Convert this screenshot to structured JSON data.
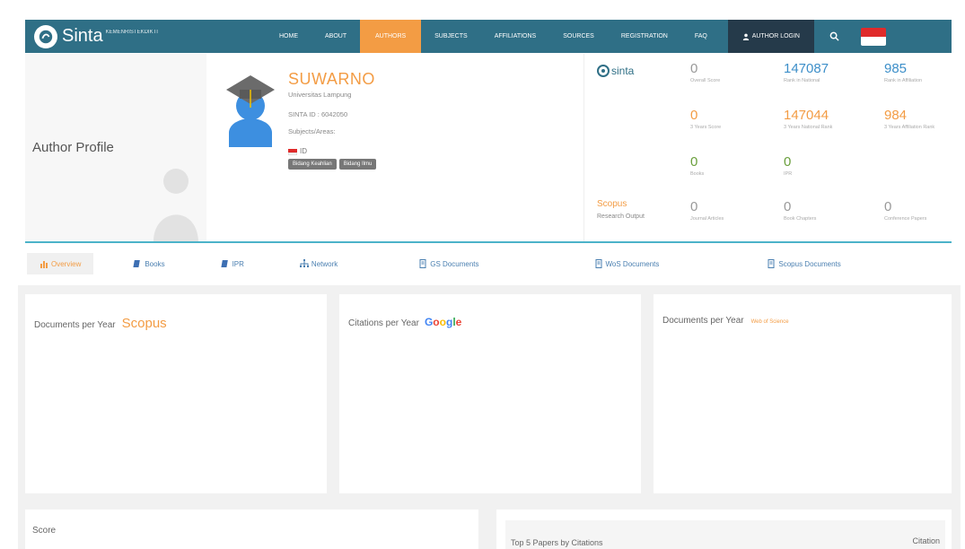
{
  "nav": {
    "brand": "Sinta",
    "brand_sub": "KEMENRISTEKDIKTI",
    "items": [
      "HOME",
      "ABOUT",
      "AUTHORS",
      "SUBJECTS",
      "AFFILIATIONS",
      "SOURCES",
      "REGISTRATION",
      "FAQ"
    ],
    "login_label": "AUTHOR LOGIN"
  },
  "profile": {
    "section_title": "Author Profile",
    "name": "SUWARNO",
    "affiliation": "Universitas Lampung",
    "sinta_id": "SINTA ID : 6042050",
    "subjects": "Subjects/Areas:",
    "country": "ID",
    "badges": [
      "Bidang Keahlian",
      "Bidang Ilmu"
    ]
  },
  "stats": {
    "sinta_label": "sinta",
    "scopus_label": "Scopus",
    "scopus_sub": "Research Output",
    "row1": [
      {
        "value": "0",
        "label": "Overall Score"
      },
      {
        "value": "147087",
        "label": "Rank in National"
      },
      {
        "value": "985",
        "label": "Rank in Affiliation"
      }
    ],
    "row2": [
      {
        "value": "0",
        "label": "3 Years Score"
      },
      {
        "value": "147044",
        "label": "3 Years National Rank"
      },
      {
        "value": "984",
        "label": "3 Years Affiliation Rank"
      }
    ],
    "row3": [
      {
        "value": "0",
        "label": "Books"
      },
      {
        "value": "0",
        "label": "IPR"
      }
    ],
    "row4": [
      {
        "value": "0",
        "label": "Journal Articles"
      },
      {
        "value": "0",
        "label": "Book Chapters"
      },
      {
        "value": "0",
        "label": "Conference Papers"
      }
    ]
  },
  "tabs": [
    "Overview",
    "Books",
    "IPR",
    "Network",
    "GS Documents",
    "WoS Documents",
    "Scopus Documents"
  ],
  "cards": {
    "docs_scopus_title": "Documents per Year",
    "scopus_word": "Scopus",
    "citations_title": "Citations per Year",
    "docs_wos_title": "Documents per Year",
    "wos_word": "Web of Science",
    "score_title": "Score",
    "top5_title": "Top 5 Papers by Citations",
    "top5_col": "Citation"
  },
  "colors": {
    "nav_bg": "#2f6f86",
    "accent_orange": "#f39c44",
    "login_bg": "#253a4a",
    "tab_line": "#4cb3c9"
  }
}
